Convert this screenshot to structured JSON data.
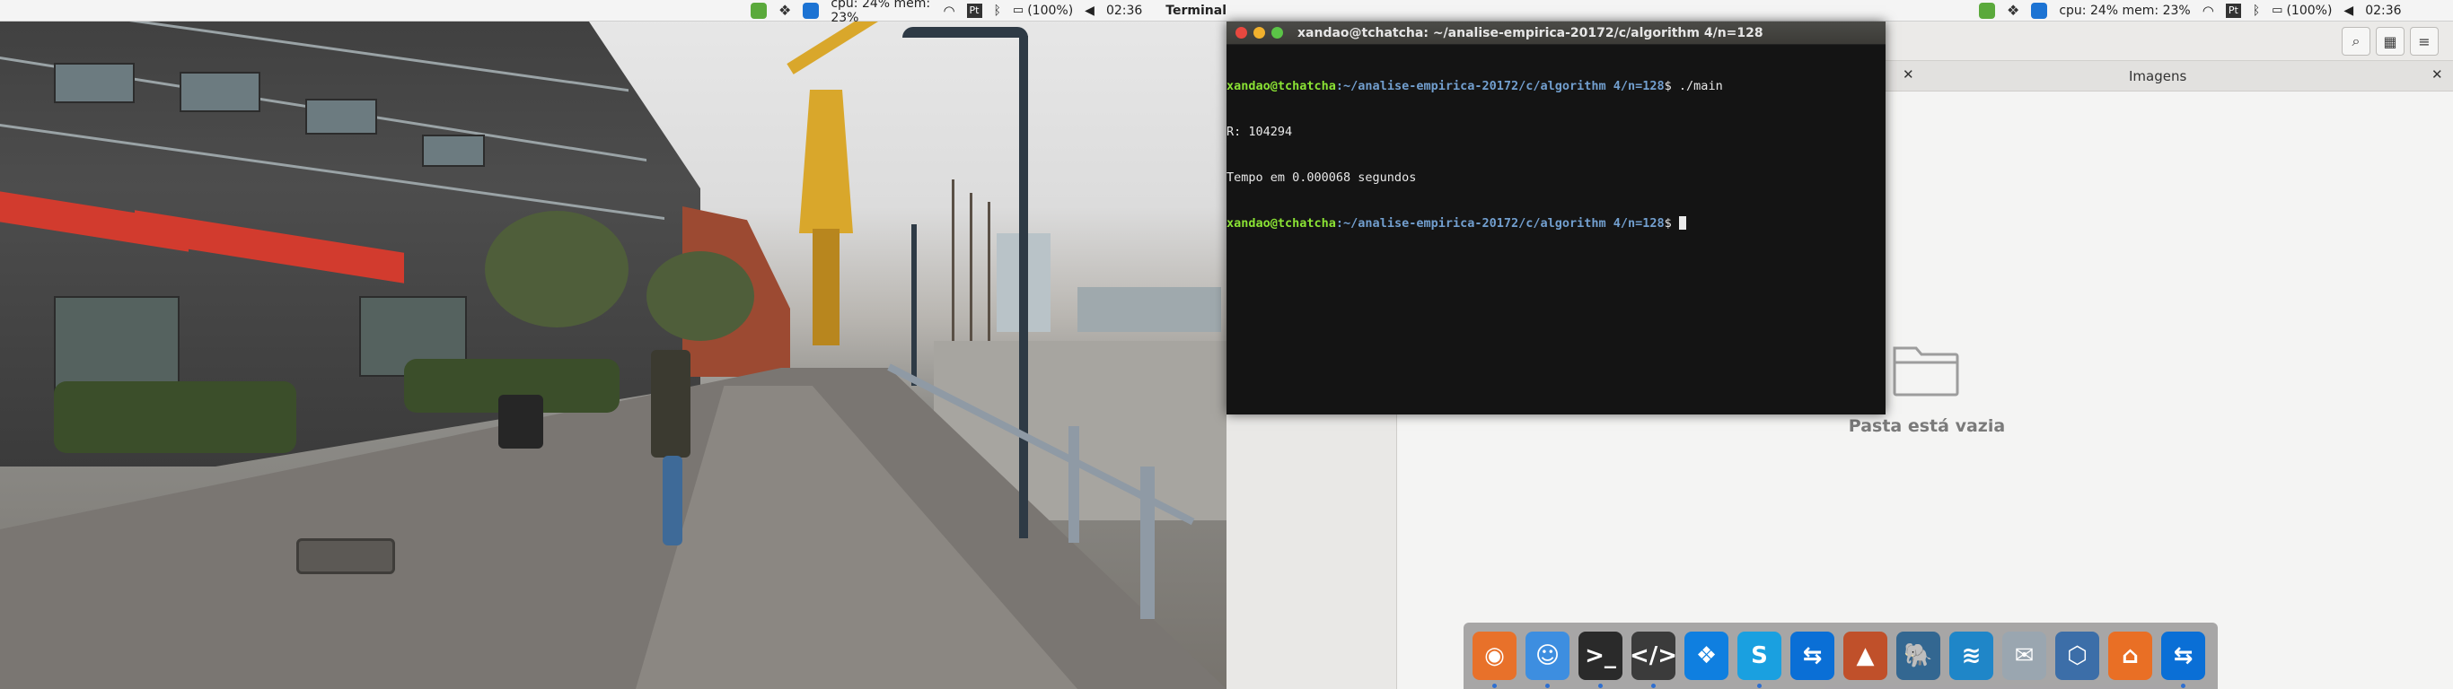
{
  "colors": {
    "prompt_user": "#8ae234",
    "prompt_path": "#729fcf",
    "terminal_bg": "#141414",
    "panel_bg": "#f2f1f0",
    "dock_bg": "#a09ea0",
    "close_red": "#e8483f",
    "minimize_yellow": "#f1b12d",
    "maximize_green": "#5bc447"
  },
  "left_topbar": {
    "status": "cpu: 24% mem: 23%",
    "battery": "(100%)",
    "clock": "02:36",
    "app_name": "Terminal",
    "indicators": [
      "checkmark-icon",
      "dropbox-icon",
      "teamviewer-icon",
      "wifi-icon",
      "keyboard-layout-icon",
      "bluetooth-icon",
      "battery-icon",
      "volume-icon",
      "apple-icon"
    ],
    "keyboard_layout": "Pt"
  },
  "right_topbar": {
    "status": "cpu: 24% mem: 23%",
    "battery": "(100%)",
    "clock": "02:36",
    "keyboard_layout": "Pt"
  },
  "terminal": {
    "title": "xandao@tchatcha: ~/analise-empirica-20172/c/algorithm 4/n=128",
    "lines": [
      {
        "user": "xandao@tchatcha",
        "path": ":~/analise-empirica-20172/c/algorithm 4/n=128",
        "cmd": "$ ./main"
      },
      {
        "text": "R: 104294"
      },
      {
        "text": "Tempo em 0.000068 segundos"
      },
      {
        "user": "xandao@tchatcha",
        "path": ":~/analise-empirica-20172/c/algorithm 4/n=128",
        "cmd": "$ "
      }
    ]
  },
  "file_manager": {
    "tab_label": "Imagens",
    "empty_message": "Pasta está vazia",
    "toolbar_icons": [
      "search-icon",
      "grid-view-icon",
      "menu-icon"
    ]
  },
  "dock": {
    "apps": [
      {
        "name": "firefox-icon",
        "color": "#e8712a",
        "glyph": "◉",
        "running": true
      },
      {
        "name": "finder-icon",
        "color": "#3d8ee0",
        "glyph": "☺",
        "running": true
      },
      {
        "name": "terminal-icon",
        "color": "#2a2a2a",
        "glyph": ">_",
        "running": true
      },
      {
        "name": "code-editor-icon",
        "color": "#3b3b3b",
        "glyph": "</>",
        "running": true
      },
      {
        "name": "dropbox-icon",
        "color": "#0f7fe0",
        "glyph": "❖",
        "running": false
      },
      {
        "name": "skype-icon",
        "color": "#1aa0e0",
        "glyph": "S",
        "running": true
      },
      {
        "name": "teamviewer-icon",
        "color": "#0a6fd6",
        "glyph": "⇆",
        "running": false
      },
      {
        "name": "matlab-icon",
        "color": "#c0502a",
        "glyph": "▲",
        "running": false
      },
      {
        "name": "postgresql-icon",
        "color": "#336791",
        "glyph": "🐘",
        "running": false
      },
      {
        "name": "mysql-workbench-icon",
        "color": "#1f86c8",
        "glyph": "≋",
        "running": false
      },
      {
        "name": "mail-icon",
        "color": "#9aa6b0",
        "glyph": "✉",
        "running": false
      },
      {
        "name": "virtualbox-icon",
        "color": "#3c6ea8",
        "glyph": "⬡",
        "running": false
      },
      {
        "name": "sourcetree-icon",
        "color": "#e96f25",
        "glyph": "⌂",
        "running": false
      },
      {
        "name": "teamviewer2-icon",
        "color": "#0a6fd6",
        "glyph": "⇆",
        "running": true
      }
    ]
  }
}
